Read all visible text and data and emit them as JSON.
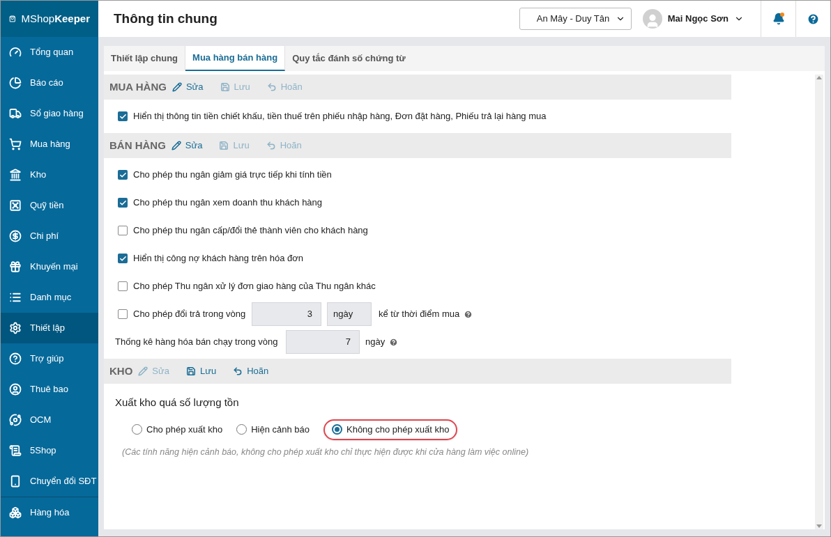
{
  "brand": {
    "name_light": "MShop",
    "name_bold": "Keeper"
  },
  "sidebar": {
    "items": [
      {
        "label": "Tổng quan",
        "selected": false
      },
      {
        "label": "Báo cáo",
        "selected": false
      },
      {
        "label": "Sổ giao hàng",
        "selected": false
      },
      {
        "label": "Mua hàng",
        "selected": false
      },
      {
        "label": "Kho",
        "selected": false
      },
      {
        "label": "Quỹ tiền",
        "selected": false
      },
      {
        "label": "Chi phí",
        "selected": false
      },
      {
        "label": "Khuyến mại",
        "selected": false
      },
      {
        "label": "Danh mục",
        "selected": false
      },
      {
        "label": "Thiết lập",
        "selected": true
      },
      {
        "label": "Trợ giúp",
        "selected": false
      },
      {
        "label": "Thuê bao",
        "selected": false
      },
      {
        "label": "OCM",
        "selected": false
      },
      {
        "label": "5Shop",
        "selected": false
      },
      {
        "label": "Chuyển đổi SĐT",
        "selected": false
      }
    ],
    "footer_item": {
      "label": "Hàng hóa",
      "selected": false
    }
  },
  "header": {
    "title": "Thông tin chung",
    "store_select": "An Mây - Duy Tân",
    "user": "Mai Ngọc Sơn",
    "notification_dot": true
  },
  "tabs": [
    {
      "label": "Thiết lập chung",
      "selected": false
    },
    {
      "label": "Mua hàng bán hàng",
      "selected": true
    },
    {
      "label": "Quy tắc đánh số chứng từ",
      "selected": false
    }
  ],
  "sections": [
    {
      "title": "MUA HÀNG",
      "actions": [
        {
          "kind": "edit",
          "label": "Sửa",
          "disabled": false
        },
        {
          "kind": "save",
          "label": "Lưu",
          "disabled": true
        },
        {
          "kind": "cancel",
          "label": "Hoãn",
          "disabled": true
        }
      ],
      "rows": [
        {
          "kind": "checkbox",
          "label": "Hiển thị thông tin tiền chiết khấu, tiền thuế trên phiếu nhập hàng, Đơn đặt hàng, Phiếu trả lại hàng mua",
          "checked": true
        }
      ]
    },
    {
      "title": "BÁN HÀNG",
      "actions": [
        {
          "kind": "edit",
          "label": "Sửa",
          "disabled": false
        },
        {
          "kind": "save",
          "label": "Lưu",
          "disabled": true
        },
        {
          "kind": "cancel",
          "label": "Hoãn",
          "disabled": true
        }
      ],
      "rows": [
        {
          "kind": "checkbox",
          "label": "Cho phép thu ngân giảm giá trực tiếp khi tính tiền",
          "checked": true
        },
        {
          "kind": "checkbox",
          "label": "Cho phép thu ngân xem doanh thu khách hàng",
          "checked": true
        },
        {
          "kind": "checkbox",
          "label": "Cho phép thu ngân cấp/đổi thẻ thành viên cho khách hàng",
          "checked": false
        },
        {
          "kind": "checkbox",
          "label": "Hiển thị công nợ khách hàng trên hóa đơn",
          "checked": true
        },
        {
          "kind": "checkbox",
          "label": "Cho phép Thu ngân xử lý đơn giao hàng của Thu ngân khác",
          "checked": false
        },
        {
          "kind": "checkbox_period",
          "label": "Cho phép đổi trả trong vòng",
          "checked": false,
          "value": "3",
          "unit": "ngày",
          "suffix": "kể từ thời điểm mua"
        },
        {
          "kind": "number",
          "label": "Thống kê hàng hóa bán chạy trong vòng",
          "value": "7",
          "suffix": "ngày"
        }
      ]
    },
    {
      "title": "KHO",
      "actions": [
        {
          "kind": "edit",
          "label": "Sửa",
          "disabled": true
        },
        {
          "kind": "save",
          "label": "Lưu",
          "disabled": false
        },
        {
          "kind": "cancel",
          "label": "Hoãn",
          "disabled": false
        }
      ],
      "group": {
        "title": "Xuất kho quá số lượng tồn",
        "options": [
          {
            "label": "Cho phép xuất kho",
            "selected": false,
            "highlighted": false
          },
          {
            "label": "Hiện cảnh báo",
            "selected": false,
            "highlighted": false
          },
          {
            "label": "Không cho phép xuất kho",
            "selected": true,
            "highlighted": true
          }
        ],
        "note": "(Các tính năng hiện cảnh báo, không cho phép xuất kho chỉ thực hiện được khi cửa hàng làm việc online)"
      }
    }
  ]
}
